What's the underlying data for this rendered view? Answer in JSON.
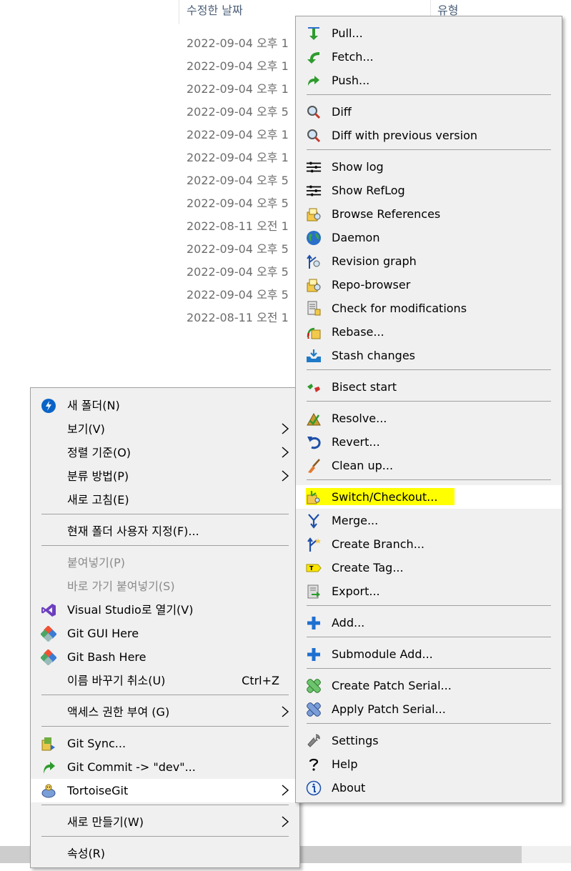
{
  "explorer": {
    "columns": {
      "modified": "수정한 날짜",
      "type": "유형"
    },
    "dates": [
      "2022-09-04 오후 1",
      "2022-09-04 오후 1",
      "2022-09-04 오후 1",
      "2022-09-04 오후 5",
      "2022-09-04 오후 1",
      "2022-09-04 오후 1",
      "2022-09-04 오후 5",
      "2022-09-04 오후 5",
      "2022-08-11 오전 1",
      "2022-09-04 오후 5",
      "2022-09-04 오후 5",
      "2022-09-04 오후 5",
      "2022-08-11 오전 1"
    ]
  },
  "context_menu": {
    "new_folder": "새 폴더(N)",
    "view": "보기(V)",
    "sort_by": "정렬 기준(O)",
    "group_by": "분류 방법(P)",
    "refresh": "새로 고침(E)",
    "customize_folder": "현재 폴더 사용자 지정(F)...",
    "paste": "붙여넣기(P)",
    "paste_shortcut": "바로 가기 붙여넣기(S)",
    "open_vs": "Visual Studio로 열기(V)",
    "git_gui": "Git GUI Here",
    "git_bash": "Git Bash Here",
    "undo_rename": "이름 바꾸기 취소(U)",
    "undo_rename_shortcut": "Ctrl+Z",
    "give_access": "액세스 권한 부여 (G)",
    "git_sync": "Git Sync...",
    "git_commit": "Git Commit -> \"dev\"...",
    "tortoisegit": "TortoiseGit",
    "new": "새로 만들기(W)",
    "properties": "속성(R)"
  },
  "tortoise_menu": {
    "pull": "Pull...",
    "fetch": "Fetch...",
    "push": "Push...",
    "diff": "Diff",
    "diff_prev": "Diff with previous version",
    "show_log": "Show log",
    "show_reflog": "Show RefLog",
    "browse_refs": "Browse References",
    "daemon": "Daemon",
    "revision_graph": "Revision graph",
    "repo_browser": "Repo-browser",
    "check_mods": "Check for modifications",
    "rebase": "Rebase...",
    "stash": "Stash changes",
    "bisect": "Bisect start",
    "resolve": "Resolve...",
    "revert": "Revert...",
    "cleanup": "Clean up...",
    "switch_checkout": "Switch/Checkout...",
    "merge": "Merge...",
    "create_branch": "Create Branch...",
    "create_tag": "Create Tag...",
    "export": "Export...",
    "add": "Add...",
    "submodule_add": "Submodule Add...",
    "create_patch": "Create Patch Serial...",
    "apply_patch": "Apply Patch Serial...",
    "settings": "Settings",
    "help": "Help",
    "about": "About"
  },
  "colors": {
    "menu_bg": "#f0f0f0",
    "hover_bg": "#ffffff",
    "highlight": "#ffff00",
    "accent_blue": "#0a64c8",
    "git_green": "#2e9b2e"
  }
}
